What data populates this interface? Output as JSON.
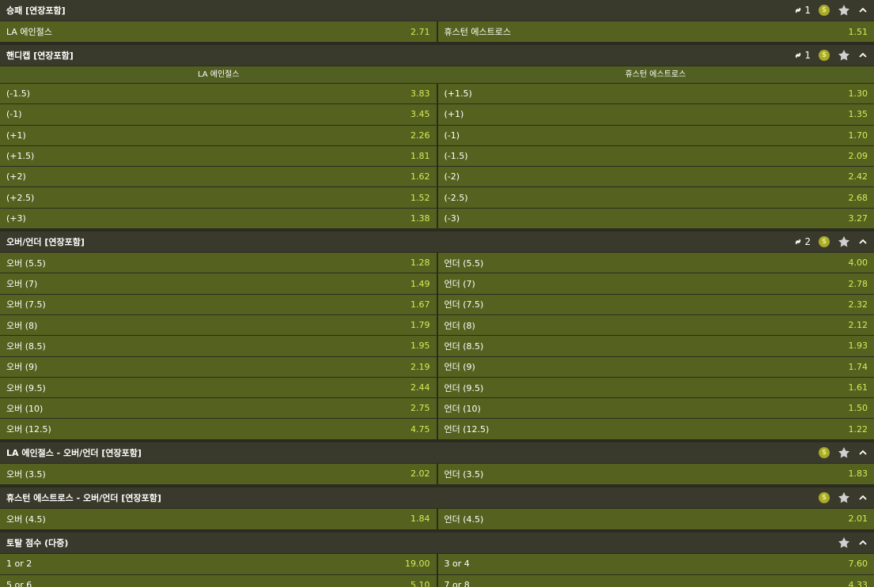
{
  "colors": {
    "bg": "#2b2b20",
    "header": "#3a3a2c",
    "cell": "#55621f",
    "odds": "#d8e85a",
    "accent": "#a8aa2a"
  },
  "icons": {
    "link": "link-icon",
    "coin": "coin-icon",
    "star": "star-icon",
    "collapse": "chevron-up-icon"
  },
  "coin_symbol": "$",
  "markets": [
    {
      "title": "승패 [연장포함]",
      "link_count": "1",
      "rows": [
        [
          {
            "label": "LA 에인절스",
            "odds": "2.71"
          },
          {
            "label": "휴스턴 에스트로스",
            "odds": "1.51"
          }
        ]
      ]
    },
    {
      "title": "핸디캡 [연장포함]",
      "link_count": "1",
      "columns": [
        "LA 에인절스",
        "휴스턴 에스트로스"
      ],
      "rows": [
        [
          {
            "label": "(-1.5)",
            "odds": "3.83"
          },
          {
            "label": "(+1.5)",
            "odds": "1.30"
          }
        ],
        [
          {
            "label": "(-1)",
            "odds": "3.45"
          },
          {
            "label": "(+1)",
            "odds": "1.35"
          }
        ],
        [
          {
            "label": "(+1)",
            "odds": "2.26"
          },
          {
            "label": "(-1)",
            "odds": "1.70"
          }
        ],
        [
          {
            "label": "(+1.5)",
            "odds": "1.81"
          },
          {
            "label": "(-1.5)",
            "odds": "2.09"
          }
        ],
        [
          {
            "label": "(+2)",
            "odds": "1.62"
          },
          {
            "label": "(-2)",
            "odds": "2.42"
          }
        ],
        [
          {
            "label": "(+2.5)",
            "odds": "1.52"
          },
          {
            "label": "(-2.5)",
            "odds": "2.68"
          }
        ],
        [
          {
            "label": "(+3)",
            "odds": "1.38"
          },
          {
            "label": "(-3)",
            "odds": "3.27"
          }
        ]
      ]
    },
    {
      "title": "오버/언더 [연장포함]",
      "link_count": "2",
      "rows": [
        [
          {
            "label": "오버 (5.5)",
            "odds": "1.28"
          },
          {
            "label": "언더 (5.5)",
            "odds": "4.00"
          }
        ],
        [
          {
            "label": "오버 (7)",
            "odds": "1.49"
          },
          {
            "label": "언더 (7)",
            "odds": "2.78"
          }
        ],
        [
          {
            "label": "오버 (7.5)",
            "odds": "1.67"
          },
          {
            "label": "언더 (7.5)",
            "odds": "2.32"
          }
        ],
        [
          {
            "label": "오버 (8)",
            "odds": "1.79"
          },
          {
            "label": "언더 (8)",
            "odds": "2.12"
          }
        ],
        [
          {
            "label": "오버 (8.5)",
            "odds": "1.95"
          },
          {
            "label": "언더 (8.5)",
            "odds": "1.93"
          }
        ],
        [
          {
            "label": "오버 (9)",
            "odds": "2.19"
          },
          {
            "label": "언더 (9)",
            "odds": "1.74"
          }
        ],
        [
          {
            "label": "오버 (9.5)",
            "odds": "2.44"
          },
          {
            "label": "언더 (9.5)",
            "odds": "1.61"
          }
        ],
        [
          {
            "label": "오버 (10)",
            "odds": "2.75"
          },
          {
            "label": "언더 (10)",
            "odds": "1.50"
          }
        ],
        [
          {
            "label": "오버 (12.5)",
            "odds": "4.75"
          },
          {
            "label": "언더 (12.5)",
            "odds": "1.22"
          }
        ]
      ]
    },
    {
      "title": "LA 에인절스 - 오버/언더 [연장포함]",
      "rows": [
        [
          {
            "label": "오버 (3.5)",
            "odds": "2.02"
          },
          {
            "label": "언더 (3.5)",
            "odds": "1.83"
          }
        ]
      ]
    },
    {
      "title": "휴스턴 에스트로스 - 오버/언더 [연장포함]",
      "rows": [
        [
          {
            "label": "오버 (4.5)",
            "odds": "1.84"
          },
          {
            "label": "언더 (4.5)",
            "odds": "2.01"
          }
        ]
      ]
    },
    {
      "title": "토탈 점수 (다중)",
      "rows": [
        [
          {
            "label": "1 or 2",
            "odds": "19.00"
          },
          {
            "label": "3 or 4",
            "odds": "7.60"
          }
        ],
        [
          {
            "label": "5 or 6",
            "odds": "5.10"
          },
          {
            "label": "7 or 8",
            "odds": "4.33"
          }
        ]
      ]
    }
  ]
}
